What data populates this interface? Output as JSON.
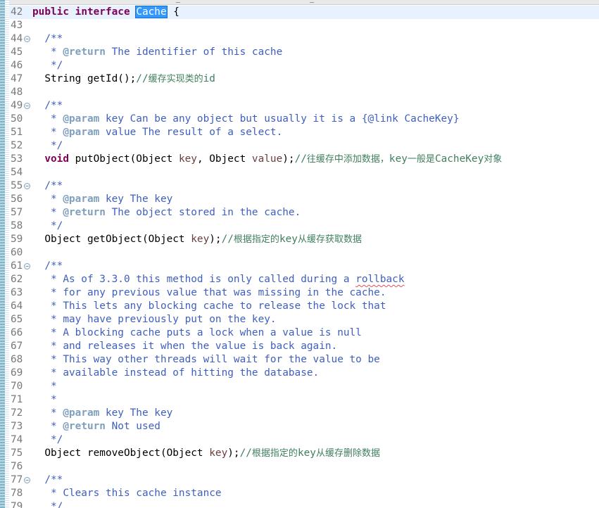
{
  "editor": {
    "language": "java",
    "selection": "Cache",
    "current_line": "42",
    "lines": [
      {
        "n": "42",
        "fold": false,
        "segs": [
          {
            "c": "kw",
            "t": "public"
          },
          {
            "c": "",
            "t": " "
          },
          {
            "c": "kw",
            "t": "interface"
          },
          {
            "c": "",
            "t": " "
          },
          {
            "c": "sel",
            "t": "Cache"
          },
          {
            "c": "caret",
            "t": ""
          },
          {
            "c": "",
            "t": " {"
          }
        ]
      },
      {
        "n": "43",
        "fold": false,
        "segs": []
      },
      {
        "n": "44",
        "fold": true,
        "segs": [
          {
            "c": "jd",
            "t": "  /**"
          }
        ]
      },
      {
        "n": "45",
        "fold": false,
        "segs": [
          {
            "c": "jd",
            "t": "   * "
          },
          {
            "c": "tag",
            "t": "@return"
          },
          {
            "c": "jd",
            "t": " The identifier of this cache"
          }
        ]
      },
      {
        "n": "46",
        "fold": false,
        "segs": [
          {
            "c": "jd",
            "t": "   */"
          }
        ]
      },
      {
        "n": "47",
        "fold": false,
        "segs": [
          {
            "c": "",
            "t": "  String getId();"
          },
          {
            "c": "cmt",
            "t": "//"
          },
          {
            "c": "cmt cjk",
            "t": "缓存实现类的"
          },
          {
            "c": "cmt",
            "t": "id"
          }
        ]
      },
      {
        "n": "48",
        "fold": false,
        "segs": []
      },
      {
        "n": "49",
        "fold": true,
        "segs": [
          {
            "c": "jd",
            "t": "  /**"
          }
        ]
      },
      {
        "n": "50",
        "fold": false,
        "segs": [
          {
            "c": "jd",
            "t": "   * "
          },
          {
            "c": "tag",
            "t": "@param"
          },
          {
            "c": "jd",
            "t": " key Can be any object but usually it is a {@link CacheKey}"
          }
        ]
      },
      {
        "n": "51",
        "fold": false,
        "segs": [
          {
            "c": "jd",
            "t": "   * "
          },
          {
            "c": "tag",
            "t": "@param"
          },
          {
            "c": "jd",
            "t": " value The result of a select."
          }
        ]
      },
      {
        "n": "52",
        "fold": false,
        "segs": [
          {
            "c": "jd",
            "t": "   */"
          }
        ]
      },
      {
        "n": "53",
        "fold": false,
        "segs": [
          {
            "c": "",
            "t": "  "
          },
          {
            "c": "kw",
            "t": "void"
          },
          {
            "c": "",
            "t": " putObject(Object "
          },
          {
            "c": "param",
            "t": "key"
          },
          {
            "c": "",
            "t": ", Object "
          },
          {
            "c": "param",
            "t": "value"
          },
          {
            "c": "",
            "t": ");"
          },
          {
            "c": "cmt",
            "t": "//"
          },
          {
            "c": "cmt cjk",
            "t": "往缓存中添加数据，"
          },
          {
            "c": "cmt",
            "t": "key"
          },
          {
            "c": "cmt cjk",
            "t": "一般是"
          },
          {
            "c": "cmt",
            "t": "CacheKey"
          },
          {
            "c": "cmt cjk",
            "t": "对象"
          }
        ]
      },
      {
        "n": "54",
        "fold": false,
        "segs": []
      },
      {
        "n": "55",
        "fold": true,
        "segs": [
          {
            "c": "jd",
            "t": "  /**"
          }
        ]
      },
      {
        "n": "56",
        "fold": false,
        "segs": [
          {
            "c": "jd",
            "t": "   * "
          },
          {
            "c": "tag",
            "t": "@param"
          },
          {
            "c": "jd",
            "t": " key The key"
          }
        ]
      },
      {
        "n": "57",
        "fold": false,
        "segs": [
          {
            "c": "jd",
            "t": "   * "
          },
          {
            "c": "tag",
            "t": "@return"
          },
          {
            "c": "jd",
            "t": " The object stored in the cache."
          }
        ]
      },
      {
        "n": "58",
        "fold": false,
        "segs": [
          {
            "c": "jd",
            "t": "   */"
          }
        ]
      },
      {
        "n": "59",
        "fold": false,
        "segs": [
          {
            "c": "",
            "t": "  Object getObject(Object "
          },
          {
            "c": "param",
            "t": "key"
          },
          {
            "c": "",
            "t": ");"
          },
          {
            "c": "cmt",
            "t": "//"
          },
          {
            "c": "cmt cjk",
            "t": "根据指定的"
          },
          {
            "c": "cmt",
            "t": "key"
          },
          {
            "c": "cmt cjk",
            "t": "从缓存获取数据"
          }
        ]
      },
      {
        "n": "60",
        "fold": false,
        "segs": []
      },
      {
        "n": "61",
        "fold": true,
        "segs": [
          {
            "c": "jd",
            "t": "  /**"
          }
        ]
      },
      {
        "n": "62",
        "fold": false,
        "segs": [
          {
            "c": "jd",
            "t": "   * As of 3.3.0 this method is only called during a "
          },
          {
            "c": "jd squiggle",
            "t": "rollback"
          }
        ]
      },
      {
        "n": "63",
        "fold": false,
        "segs": [
          {
            "c": "jd",
            "t": "   * for any previous value that was missing in the cache."
          }
        ]
      },
      {
        "n": "64",
        "fold": false,
        "segs": [
          {
            "c": "jd",
            "t": "   * This lets any blocking cache to release the lock that"
          }
        ]
      },
      {
        "n": "65",
        "fold": false,
        "segs": [
          {
            "c": "jd",
            "t": "   * may have previously put on the key."
          }
        ]
      },
      {
        "n": "66",
        "fold": false,
        "segs": [
          {
            "c": "jd",
            "t": "   * A blocking cache puts a lock when a value is null"
          }
        ]
      },
      {
        "n": "67",
        "fold": false,
        "segs": [
          {
            "c": "jd",
            "t": "   * and releases it when the value is back again."
          }
        ]
      },
      {
        "n": "68",
        "fold": false,
        "segs": [
          {
            "c": "jd",
            "t": "   * This way other threads will wait for the value to be"
          }
        ]
      },
      {
        "n": "69",
        "fold": false,
        "segs": [
          {
            "c": "jd",
            "t": "   * available instead of hitting the database."
          }
        ]
      },
      {
        "n": "70",
        "fold": false,
        "segs": [
          {
            "c": "jd",
            "t": "   *"
          }
        ]
      },
      {
        "n": "71",
        "fold": false,
        "segs": [
          {
            "c": "jd",
            "t": "   *"
          }
        ]
      },
      {
        "n": "72",
        "fold": false,
        "segs": [
          {
            "c": "jd",
            "t": "   * "
          },
          {
            "c": "tag",
            "t": "@param"
          },
          {
            "c": "jd",
            "t": " key The key"
          }
        ]
      },
      {
        "n": "73",
        "fold": false,
        "segs": [
          {
            "c": "jd",
            "t": "   * "
          },
          {
            "c": "tag",
            "t": "@return"
          },
          {
            "c": "jd",
            "t": " Not used"
          }
        ]
      },
      {
        "n": "74",
        "fold": false,
        "segs": [
          {
            "c": "jd",
            "t": "   */"
          }
        ]
      },
      {
        "n": "75",
        "fold": false,
        "segs": [
          {
            "c": "",
            "t": "  Object removeObject(Object "
          },
          {
            "c": "param",
            "t": "key"
          },
          {
            "c": "",
            "t": ");"
          },
          {
            "c": "cmt",
            "t": "//"
          },
          {
            "c": "cmt cjk",
            "t": "根据指定的"
          },
          {
            "c": "cmt",
            "t": "key"
          },
          {
            "c": "cmt cjk",
            "t": "从缓存删除数据"
          }
        ]
      },
      {
        "n": "76",
        "fold": false,
        "segs": []
      },
      {
        "n": "77",
        "fold": true,
        "segs": [
          {
            "c": "jd",
            "t": "  /**"
          }
        ]
      },
      {
        "n": "78",
        "fold": false,
        "segs": [
          {
            "c": "jd",
            "t": "   * Clears this cache instance"
          }
        ]
      },
      {
        "n": "79",
        "fold": false,
        "segs": [
          {
            "c": "jd",
            "t": "   */"
          }
        ]
      }
    ]
  }
}
